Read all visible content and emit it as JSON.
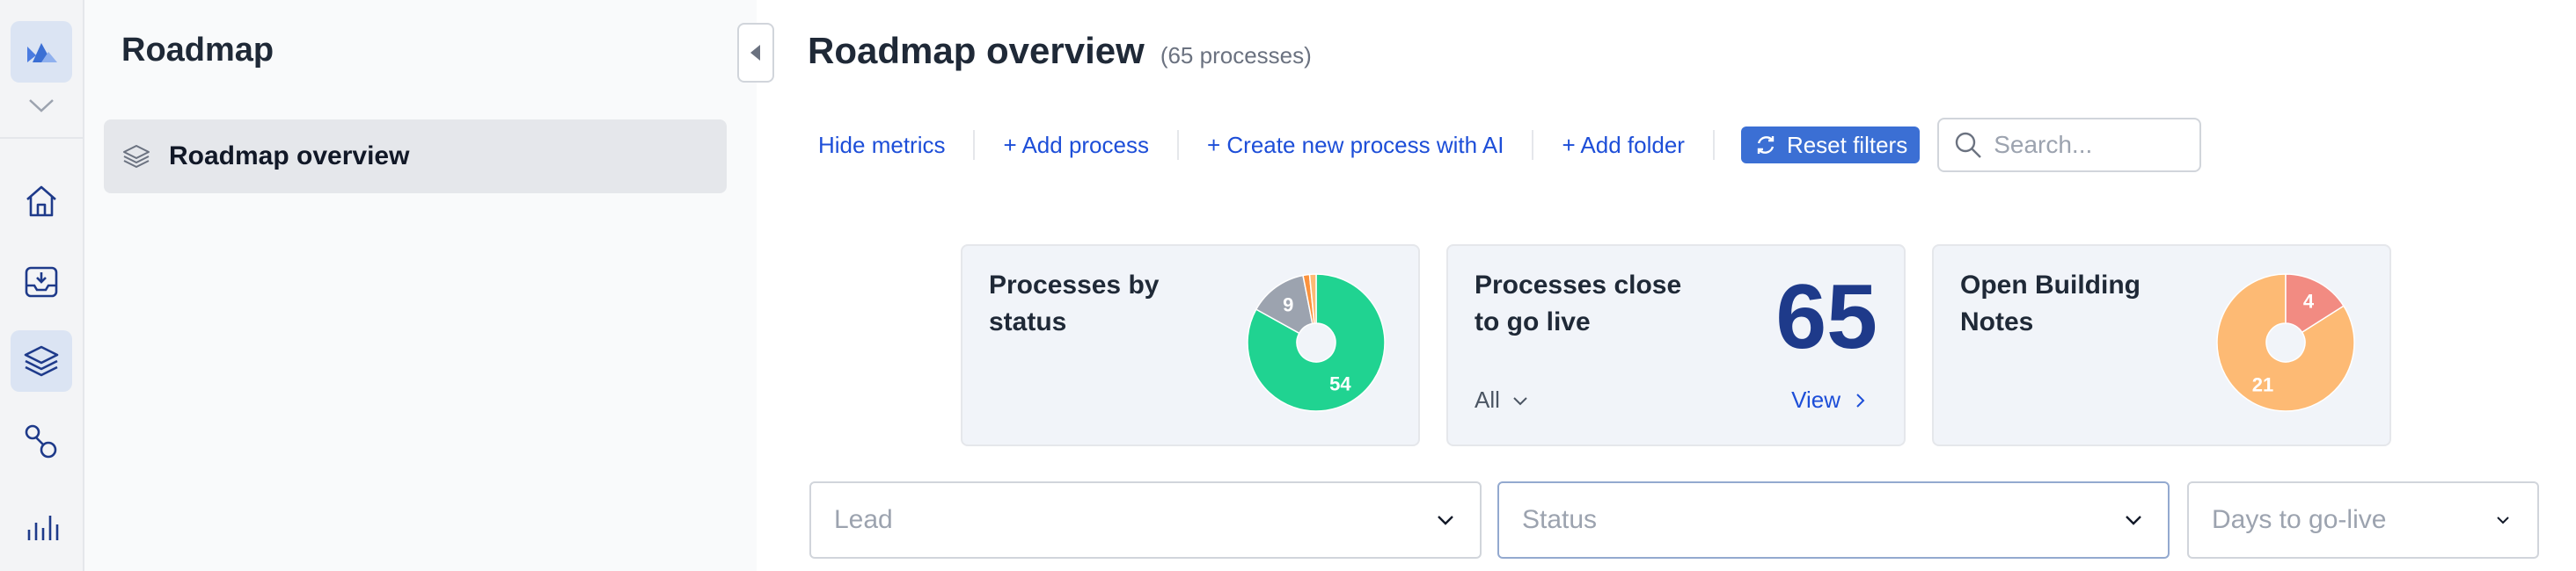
{
  "rail": {
    "items": [
      {
        "name": "logo-icon"
      },
      {
        "name": "home-icon"
      },
      {
        "name": "inbox-icon"
      },
      {
        "name": "layers-icon",
        "active": true
      },
      {
        "name": "workflow-icon"
      },
      {
        "name": "analytics-icon"
      }
    ]
  },
  "sidebar": {
    "title": "Roadmap",
    "items": [
      {
        "label": "Roadmap overview",
        "icon": "layers-icon",
        "active": true
      }
    ]
  },
  "main": {
    "title": "Roadmap overview",
    "count": "(65 processes)"
  },
  "toolbar": {
    "hide_metrics": "Hide metrics",
    "add_process": "+ Add process",
    "create_ai": "+ Create new process with AI",
    "add_folder": "+ Add folder",
    "reset_filters": "Reset filters",
    "search_placeholder": "Search..."
  },
  "metrics": {
    "status_card": {
      "title": "Processes by status",
      "chart_data": {
        "type": "pie",
        "categories": [
          "",
          "",
          "",
          ""
        ],
        "values": [
          54,
          9,
          1,
          1
        ],
        "value_labels": [
          "54",
          "9",
          "",
          ""
        ],
        "colors": [
          "#20d391",
          "#9ca3af",
          "#fb923c",
          "#fdba74"
        ]
      }
    },
    "go_live_card": {
      "title": "Processes close to go live",
      "value": "65",
      "filter_value": "All",
      "link": "View"
    },
    "notes_card": {
      "title": "Open Building Notes",
      "chart_data": {
        "type": "pie",
        "categories": [
          "",
          ""
        ],
        "values": [
          21,
          4
        ],
        "value_labels": [
          "21",
          "4"
        ],
        "colors": [
          "#fdba74",
          "#f28b82"
        ]
      }
    }
  },
  "filters": {
    "lead_placeholder": "Lead",
    "status_placeholder": "Status",
    "days_placeholder": "Days to go-live"
  },
  "colors": {
    "accent": "#3b6fd4",
    "link": "#1d4ed8",
    "big_number": "#1e3a8a"
  }
}
